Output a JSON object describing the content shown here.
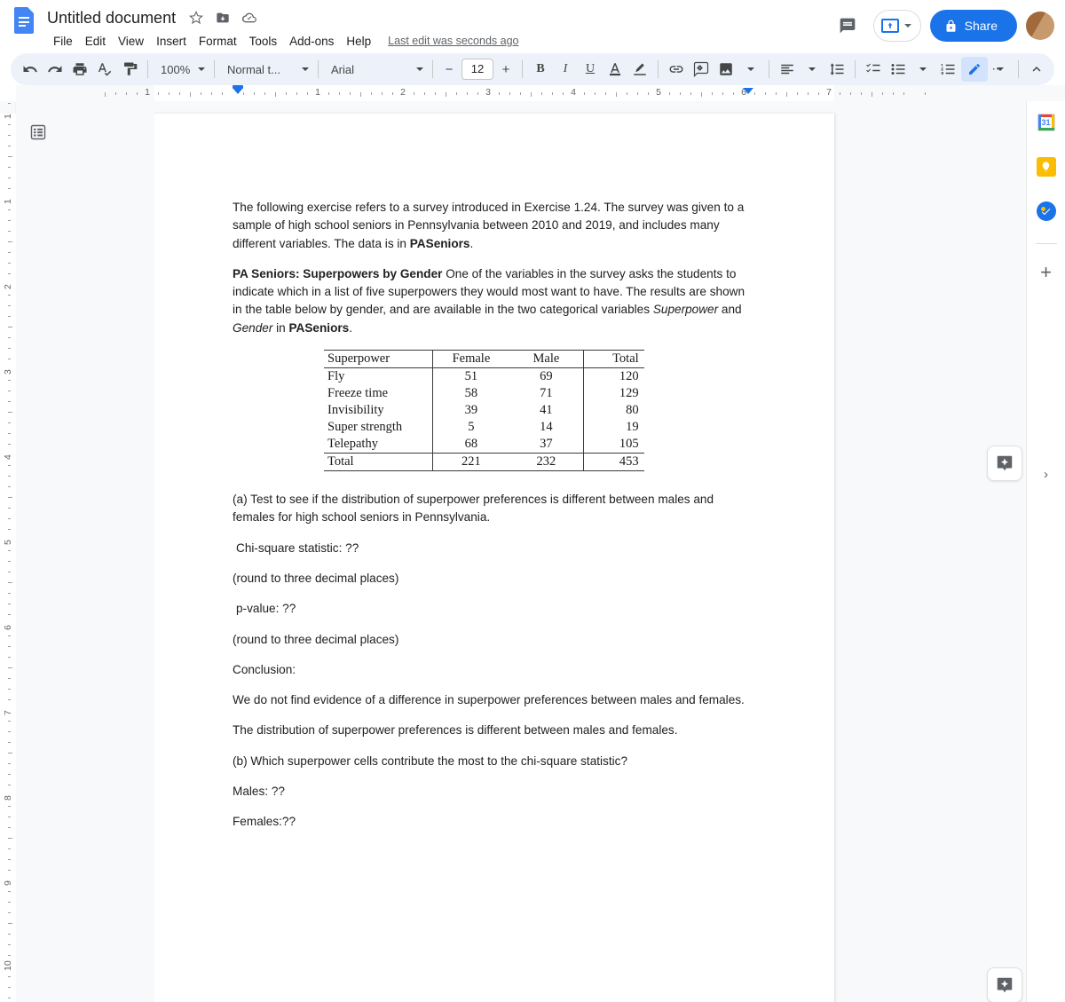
{
  "app": {
    "doc_title": "Untitled document",
    "title_icons": [
      "star-icon",
      "move-to-folder-icon",
      "cloud-saved-icon"
    ],
    "menus": [
      "File",
      "Edit",
      "View",
      "Insert",
      "Format",
      "Tools",
      "Add-ons",
      "Help"
    ],
    "last_edit": "Last edit was seconds ago",
    "comment_history_label": "comment-history-icon",
    "present_label": "present-icon",
    "share_label": "Share",
    "avatar_label": "account-avatar"
  },
  "toolbar": {
    "undo": "undo-icon",
    "redo": "redo-icon",
    "print": "print-icon",
    "spellcheck": "spellcheck-icon",
    "paint_format": "paint-format-icon",
    "zoom_value": "100%",
    "style_value": "Normal t...",
    "font_value": "Arial",
    "font_size_decrease": "−",
    "font_size_value": "12",
    "font_size_increase": "+",
    "bold": "B",
    "italic": "I",
    "underline": "U",
    "text_color": "A",
    "highlight": "highlight-icon",
    "link": "link-icon",
    "comment": "add-comment-icon",
    "image": "insert-image-icon",
    "align": "align-icon",
    "line_spacing": "line-spacing-icon",
    "checklist": "checklist-icon",
    "bulleted_list": "bulleted-list-icon",
    "numbered_list": "numbered-list-icon",
    "more": "⋯",
    "editing_mode": "editing-mode-icon",
    "collapse": "collapse-toolbar-icon"
  },
  "ruler": {
    "h_numbers": [
      "1",
      "1",
      "2",
      "3",
      "4",
      "5",
      "6",
      "7"
    ],
    "v_numbers": [
      "1",
      "1",
      "2",
      "3",
      "4",
      "5",
      "6",
      "7",
      "8",
      "9",
      "10"
    ]
  },
  "gutter": {
    "outline_toggle": "document-outline-icon"
  },
  "document": {
    "para1": {
      "a": "The following exercise refers to a survey introduced in Exercise 1.24. The survey was given to a sample of high school seniors in Pennsylvania between 2010 and 2019, and includes many different variables. The data is in ",
      "b": "PASeniors",
      "c": "."
    },
    "para2": {
      "bold_lead": "PA Seniors: Superpowers by Gender",
      "a": " One of the variables in the survey asks the students to indicate which in a list of five superpowers they would most want to have. The results are shown in the table below by gender, and are available in the two categorical variables ",
      "i1": "Superpower",
      "mid": " and ",
      "i2": "Gender",
      "b2": " in ",
      "bold2": "PASeniors",
      "end": "."
    },
    "part_a": "(a) Test to see if the distribution of superpower preferences is different between males and females for high school seniors in Pennsylvania.",
    "chi_square_line": "Chi-square statistic: ??",
    "round_note_1": "(round to three decimal places)",
    "p_value_line": "p-value: ??",
    "round_note_2": "(round to three decimal places)",
    "conclusion_label": "Conclusion:",
    "conclusion_opt_1": " We do not find evidence of a difference in superpower preferences between males and females.",
    "conclusion_opt_2": "The distribution of superpower preferences is different between males and females.",
    "part_b": "(b) Which superpower cells contribute the most to the chi-square statistic?",
    "males_line": "Males: ??",
    "females_line": "Females:??"
  },
  "table_data": {
    "type": "table",
    "title": "PA Seniors: Superpowers by Gender",
    "columns": [
      "Superpower",
      "Female",
      "Male",
      "Total"
    ],
    "rows": [
      [
        "Fly",
        "51",
        "69",
        "120"
      ],
      [
        "Freeze time",
        "58",
        "71",
        "129"
      ],
      [
        "Invisibility",
        "39",
        "41",
        "80"
      ],
      [
        "Super strength",
        "5",
        "14",
        "19"
      ],
      [
        "Telepathy",
        "68",
        "37",
        "105"
      ]
    ],
    "total_row": [
      "Total",
      "221",
      "232",
      "453"
    ]
  },
  "sidebar": {
    "items": [
      {
        "name": "google-calendar-icon",
        "label": "31"
      },
      {
        "name": "google-keep-icon",
        "label": ""
      },
      {
        "name": "google-tasks-icon",
        "label": ""
      }
    ],
    "add_label": "+",
    "expand_label": "›"
  },
  "floating": {
    "comment_button": "add-comment-button"
  },
  "colors": {
    "brand_blue": "#1a73e8",
    "toolbar_bg": "#edf2fa",
    "canvas_bg": "#f8f9fa",
    "text": "#202124",
    "keep_yellow": "#fbbc04"
  }
}
